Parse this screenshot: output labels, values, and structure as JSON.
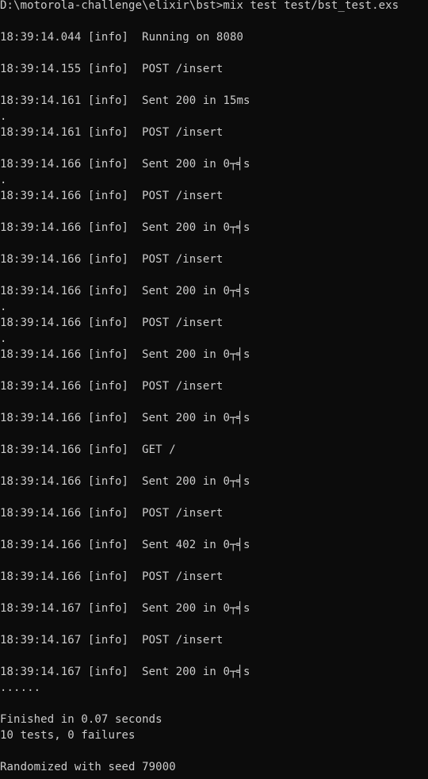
{
  "terminal": {
    "lines": [
      "D:\\motorola-challenge\\elixir\\bst>mix test test/bst_test.exs",
      "",
      "18:39:14.044 [info]  Running on 8080",
      "",
      "18:39:14.155 [info]  POST /insert",
      "",
      "18:39:14.161 [info]  Sent 200 in 15ms",
      ".",
      "18:39:14.161 [info]  POST /insert",
      "",
      "18:39:14.166 [info]  Sent 200 in 0┬╡s",
      ".",
      "18:39:14.166 [info]  POST /insert",
      "",
      "18:39:14.166 [info]  Sent 200 in 0┬╡s",
      "",
      "18:39:14.166 [info]  POST /insert",
      "",
      "18:39:14.166 [info]  Sent 200 in 0┬╡s",
      ".",
      "18:39:14.166 [info]  POST /insert",
      ".",
      "18:39:14.166 [info]  Sent 200 in 0┬╡s",
      "",
      "18:39:14.166 [info]  POST /insert",
      "",
      "18:39:14.166 [info]  Sent 200 in 0┬╡s",
      "",
      "18:39:14.166 [info]  GET /",
      "",
      "18:39:14.166 [info]  Sent 200 in 0┬╡s",
      "",
      "18:39:14.166 [info]  POST /insert",
      "",
      "18:39:14.166 [info]  Sent 402 in 0┬╡s",
      "",
      "18:39:14.166 [info]  POST /insert",
      "",
      "18:39:14.167 [info]  Sent 200 in 0┬╡s",
      "",
      "18:39:14.167 [info]  POST /insert",
      "",
      "18:39:14.167 [info]  Sent 200 in 0┬╡s",
      "......",
      "",
      "Finished in 0.07 seconds",
      "10 tests, 0 failures",
      "",
      "Randomized with seed 79000"
    ]
  }
}
